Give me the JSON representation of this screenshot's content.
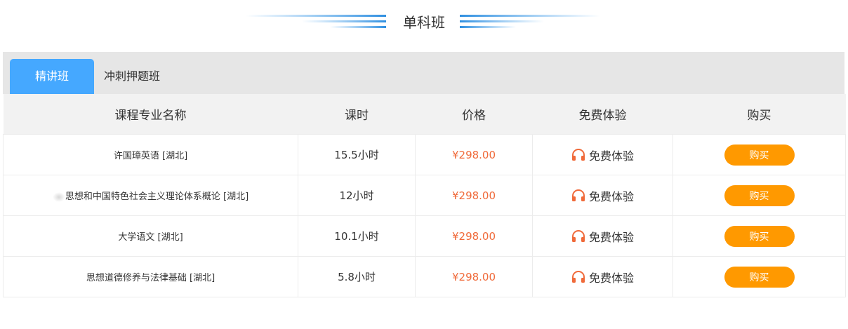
{
  "section": {
    "title": "单科班"
  },
  "tabs": [
    {
      "label": "精讲班",
      "active": true
    },
    {
      "label": "冲刺押题班",
      "active": false
    }
  ],
  "table": {
    "headers": [
      "课程专业名称",
      "课时",
      "价格",
      "免费体验",
      "购买"
    ],
    "rows": [
      {
        "name": "许国璋英语 [湖北]",
        "hours": "15.5小时",
        "price": "¥298.00",
        "trial": "免费体验",
        "buy": "购买"
      },
      {
        "name": "思想和中国特色社会主义理论体系概论 [湖北]",
        "hours": "12小时",
        "price": "¥298.00",
        "trial": "免费体验",
        "buy": "购买"
      },
      {
        "name": "大学语文 [湖北]",
        "hours": "10.1小时",
        "price": "¥298.00",
        "trial": "免费体验",
        "buy": "购买"
      },
      {
        "name": "思想道德修养与法律基础 [湖北]",
        "hours": "5.8小时",
        "price": "¥298.00",
        "trial": "免费体验",
        "buy": "购买"
      }
    ]
  },
  "colors": {
    "accent_blue": "#45a8ff",
    "price_orange": "#f06a3a",
    "buy_orange": "#ff9900",
    "tab_bar_gray": "#e6e6e6"
  },
  "icons": {
    "trial": "headphones-icon"
  }
}
